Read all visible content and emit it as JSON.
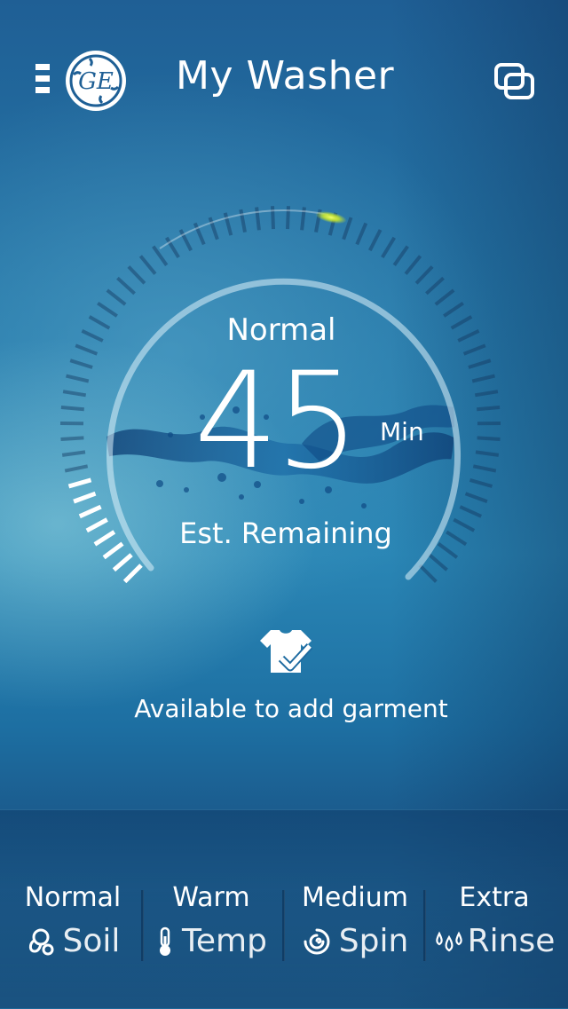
{
  "header": {
    "title": "My Washer",
    "menu_icon": "menu-icon",
    "logo_icon": "ge-logo",
    "switch_icon": "switch-appliance-icon"
  },
  "cycle": {
    "name": "Normal",
    "time_value": "45",
    "time_unit": "Min",
    "remaining_label": "Est. Remaining",
    "progress_fraction": 0.12
  },
  "status": {
    "icon": "shirt-check-icon",
    "text": "Available to add garment"
  },
  "settings": [
    {
      "value": "Normal",
      "label": "Soil",
      "icon": "soil-icon"
    },
    {
      "value": "Warm",
      "label": "Temp",
      "icon": "thermometer-icon"
    },
    {
      "value": "Medium",
      "label": "Spin",
      "icon": "spin-icon"
    },
    {
      "value": "Extra",
      "label": "Rinse",
      "icon": "rinse-drops-icon"
    }
  ],
  "colors": {
    "accent_glow": "#d6f020",
    "text": "#ffffff"
  }
}
